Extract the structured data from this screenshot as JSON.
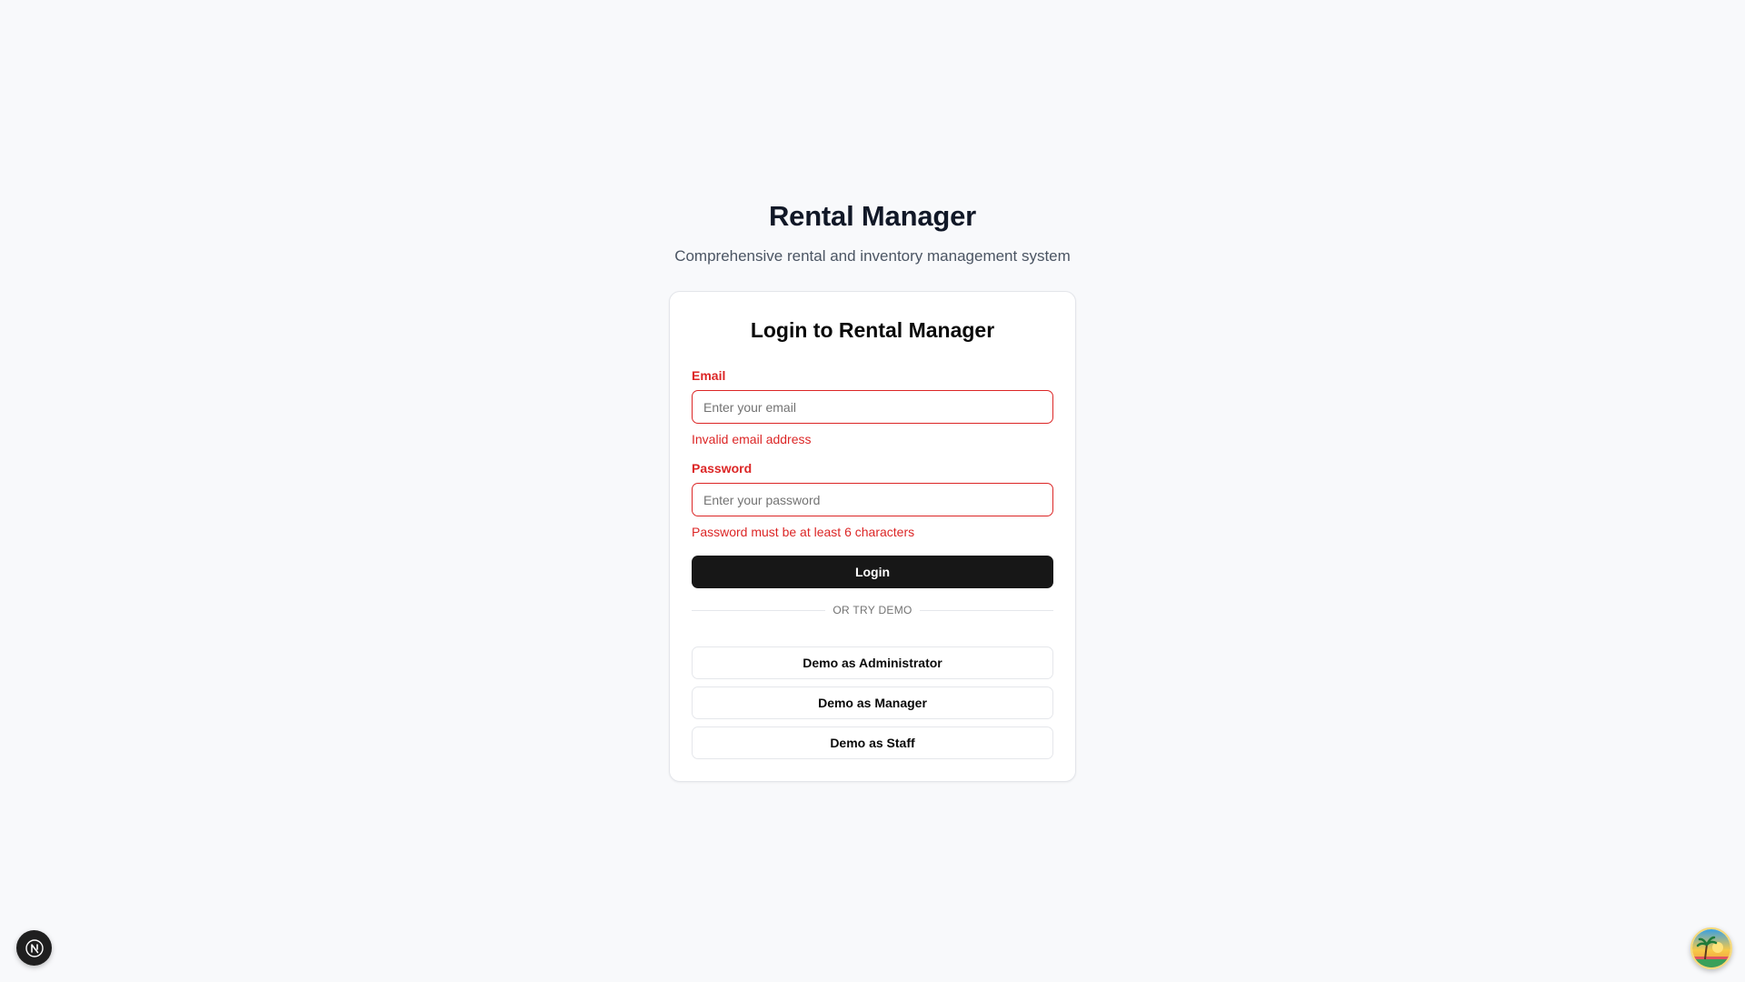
{
  "header": {
    "title": "Rental Manager",
    "subtitle": "Comprehensive rental and inventory management system"
  },
  "login_card": {
    "title": "Login to Rental Manager",
    "email": {
      "label": "Email",
      "placeholder": "Enter your email",
      "value": "",
      "error": "Invalid email address"
    },
    "password": {
      "label": "Password",
      "placeholder": "Enter your password",
      "value": "",
      "error": "Password must be at least 6 characters"
    },
    "login_button": "Login",
    "divider_text": "OR TRY DEMO",
    "demo_buttons": [
      "Demo as Administrator",
      "Demo as Manager",
      "Demo as Staff"
    ]
  },
  "dev_badge": {
    "icon": "nextjs-n-icon"
  },
  "avatar": {
    "icon": "palm-tree-sunset-avatar"
  },
  "colors": {
    "background": "#f8f9fb",
    "error": "#dc2626",
    "primary_button": "#171717",
    "card_border": "#e3e5ea"
  }
}
